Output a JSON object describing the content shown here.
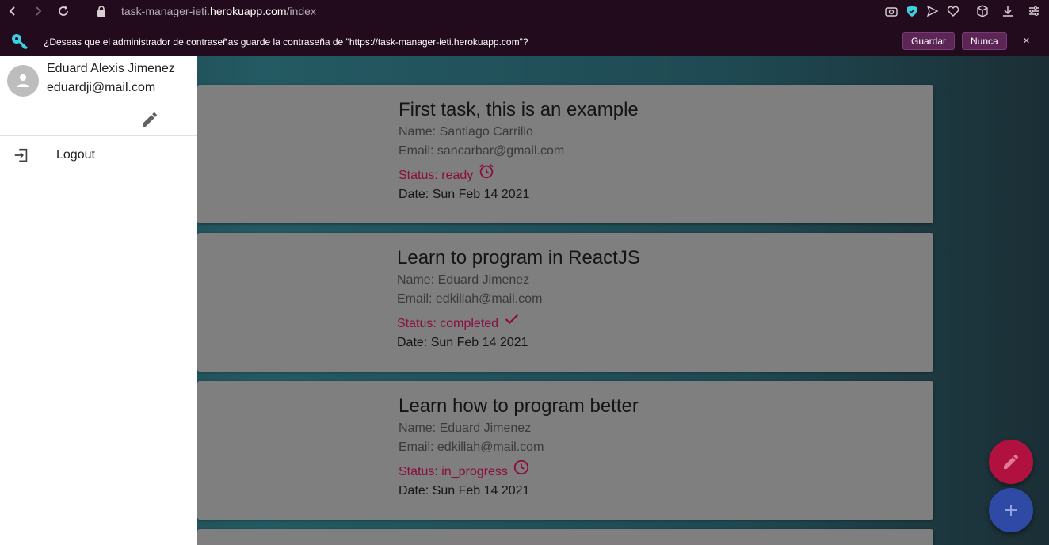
{
  "browser": {
    "url_prefix": "task-manager-ieti.",
    "url_host": "herokuapp.com",
    "url_path": "/index"
  },
  "password_prompt": {
    "message": "¿Deseas que el administrador de contraseñas guarde la contraseña de \"https://task-manager-ieti.herokuapp.com\"?",
    "save_label": "Guardar",
    "never_label": "Nunca",
    "close_label": "×"
  },
  "drawer": {
    "user_name": "Eduard Alexis Jimenez",
    "user_email": "eduardji@mail.com",
    "logout_label": "Logout"
  },
  "tasks": [
    {
      "title": "First task, this is an example",
      "name": "Name: Santiago Carrillo",
      "email": "Email: sancarbar@gmail.com",
      "status": "Status: ready",
      "status_icon": "alarm-icon",
      "date": "Date: Sun Feb 14 2021"
    },
    {
      "title": "Learn to program in ReactJS",
      "name": "Name: Eduard Jimenez",
      "email": "Email: edkillah@mail.com",
      "status": "Status: completed",
      "status_icon": "check-icon",
      "date": "Date: Sun Feb 14 2021"
    },
    {
      "title": "Learn how to program better",
      "name": "Name: Eduard Jimenez",
      "email": "Email: edkillah@mail.com",
      "status": "Status: in_progress",
      "status_icon": "clock-icon",
      "date": "Date: Sun Feb 14 2021"
    }
  ],
  "colors": {
    "status_text": "#8a0c3e",
    "fab_edit": "#b0113f",
    "fab_add": "#2f4aa4",
    "browser_bar": "#230b1e"
  }
}
